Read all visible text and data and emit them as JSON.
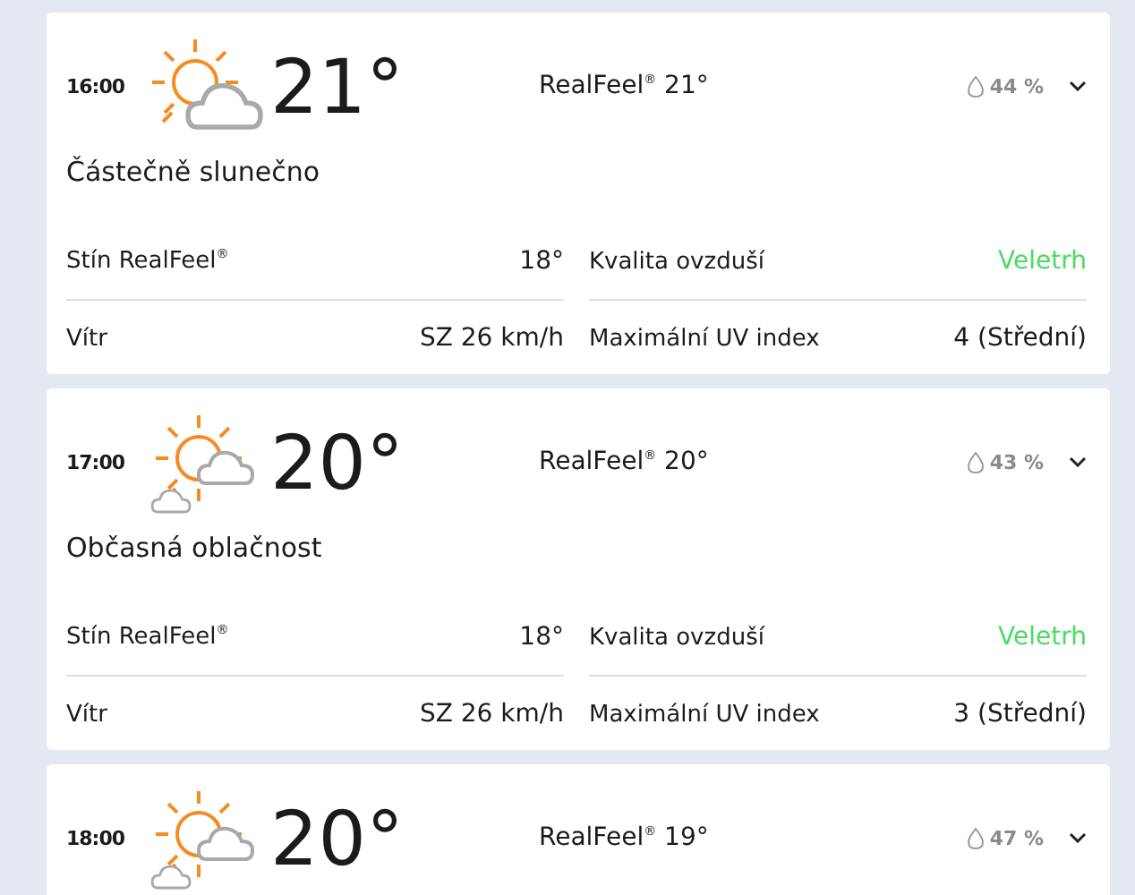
{
  "hours": [
    {
      "time": "16:00",
      "icon": {
        "kind": "partly-sunny"
      },
      "temp": "21°",
      "realfeel": "RealFeel$^{®}$ 21°",
      "precip": "44 %",
      "expanded": false,
      "phrase": "Částečně slunečno",
      "details": [
        {
          "label": "Stín RealFeel$^{®}$",
          "value": "18°"
        },
        {
          "label": "Kvalita ovzduší",
          "value": "Veletrh",
          "color": "#4cd964"
        },
        {
          "label": "Vítr",
          "value": "SZ 26 km/h"
        },
        {
          "label": "Maximální UV index",
          "value": "4 (Střední)"
        }
      ]
    },
    {
      "time": "17:00",
      "icon": {
        "kind": "intermittent-clouds"
      },
      "temp": "20°",
      "realfeel": "RealFeel$^{®}$ 20°",
      "precip": "43 %",
      "expanded": false,
      "phrase": "Občasná oblačnost",
      "details": [
        {
          "label": "Stín RealFeel$^{®}$",
          "value": "18°"
        },
        {
          "label": "Kvalita ovzduší",
          "value": "Veletrh",
          "color": "#4cd964"
        },
        {
          "label": "Vítr",
          "value": "SZ 26 km/h"
        },
        {
          "label": "Maximální UV index",
          "value": "3 (Střední)"
        }
      ]
    },
    {
      "time": "18:00",
      "icon": {
        "kind": "intermittent-clouds"
      },
      "temp": "20°",
      "realfeel": "RealFeel$^{®}$ 19°",
      "precip": "47 %",
      "expanded": false
    }
  ]
}
